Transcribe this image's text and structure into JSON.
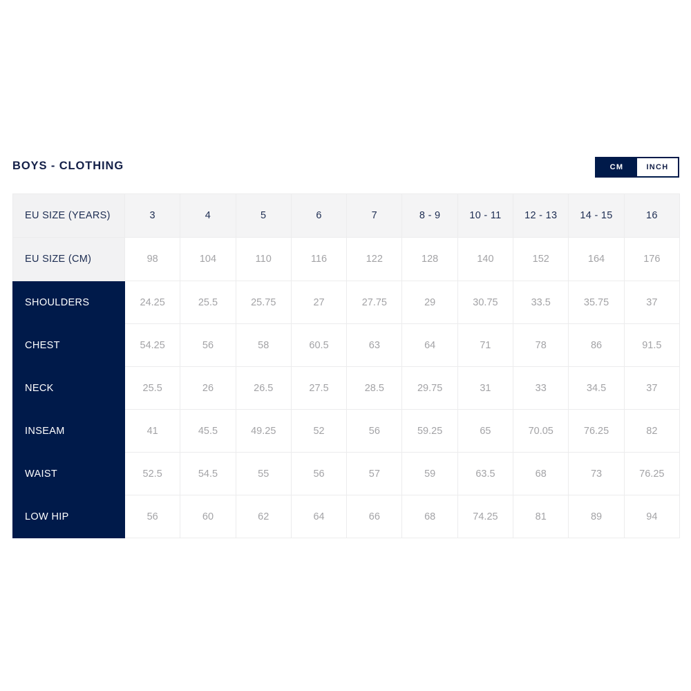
{
  "header": {
    "title": "BOYS - CLOTHING",
    "unit_toggle": {
      "cm_label": "CM",
      "inch_label": "INCH",
      "selected": "CM"
    }
  },
  "colors": {
    "navy": "#001a4a",
    "title_navy": "#142048",
    "header_gray": "#f4f4f5",
    "label_gray": "#f2f2f3",
    "value_gray": "#a3a3a6",
    "border": "#ececed"
  },
  "chart_data": {
    "type": "table",
    "title": "BOYS - CLOTHING",
    "unit": "CM",
    "row_header_labels": [
      "EU SIZE (YEARS)",
      "EU SIZE (CM)"
    ],
    "categories": [
      "3",
      "4",
      "5",
      "6",
      "7",
      "8 - 9",
      "10 - 11",
      "12 - 13",
      "14 - 15",
      "16"
    ],
    "eu_size_cm": [
      "98",
      "104",
      "110",
      "116",
      "122",
      "128",
      "140",
      "152",
      "164",
      "176"
    ],
    "measurement_labels": [
      "SHOULDERS",
      "CHEST",
      "NECK",
      "INSEAM",
      "WAIST",
      "LOW HIP"
    ],
    "series": [
      {
        "name": "SHOULDERS",
        "values": [
          "24.25",
          "25.5",
          "25.75",
          "27",
          "27.75",
          "29",
          "30.75",
          "33.5",
          "35.75",
          "37"
        ]
      },
      {
        "name": "CHEST",
        "values": [
          "54.25",
          "56",
          "58",
          "60.5",
          "63",
          "64",
          "71",
          "78",
          "86",
          "91.5"
        ]
      },
      {
        "name": "NECK",
        "values": [
          "25.5",
          "26",
          "26.5",
          "27.5",
          "28.5",
          "29.75",
          "31",
          "33",
          "34.5",
          "37"
        ]
      },
      {
        "name": "INSEAM",
        "values": [
          "41",
          "45.5",
          "49.25",
          "52",
          "56",
          "59.25",
          "65",
          "70.05",
          "76.25",
          "82"
        ]
      },
      {
        "name": "WAIST",
        "values": [
          "52.5",
          "54.5",
          "55",
          "56",
          "57",
          "59",
          "63.5",
          "68",
          "73",
          "76.25"
        ]
      },
      {
        "name": "LOW HIP",
        "values": [
          "56",
          "60",
          "62",
          "64",
          "66",
          "68",
          "74.25",
          "81",
          "89",
          "94"
        ]
      }
    ]
  }
}
